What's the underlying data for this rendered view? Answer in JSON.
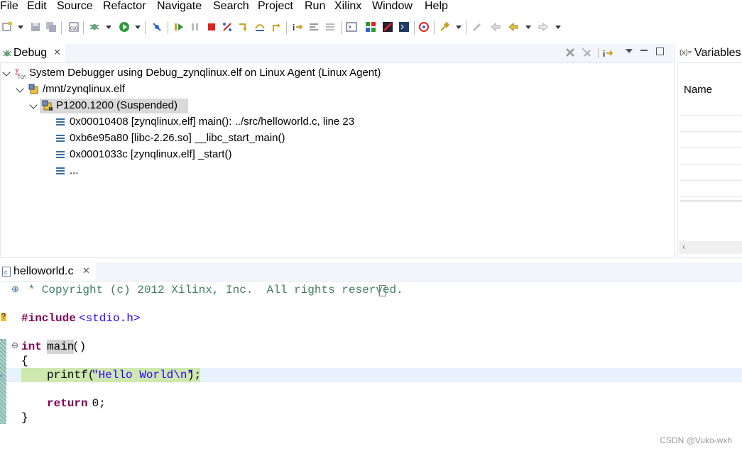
{
  "menu": [
    "File",
    "Edit",
    "Source",
    "Refactor",
    "Navigate",
    "Search",
    "Project",
    "Run",
    "Xilinx",
    "Window",
    "Help"
  ],
  "debug_view": {
    "tab_label": "Debug",
    "tree": {
      "launch": "System Debugger using Debug_zynqlinux.elf on Linux Agent (Linux Agent)",
      "process": "/mnt/zynqlinux.elf",
      "thread": "P1200.1200 (Suspended)",
      "frames": [
        "0x00010408 [zynqlinux.elf] main(): ../src/helloworld.c, line 23",
        "0xb6e95a80 [libc-2.26.so] __libc_start_main()",
        "0x0001033c [zynqlinux.elf] _start()",
        "..."
      ]
    }
  },
  "variables_view": {
    "tab_label": "Variables",
    "tab_prefix": "(x)=",
    "column_name": "Name"
  },
  "editor": {
    "tab_label": "helloworld.c",
    "lines": {
      "copyright": " * Copyright (c) 2012 Xilinx, Inc.  All rights reserved.",
      "include_kw": "#include",
      "include_hdr": "<stdio.h>",
      "int_kw": "int",
      "main_name": "main",
      "main_parens": "()",
      "open_brace": "{",
      "printf_pre": "printf(",
      "printf_str": "\"Hello World\\n\"",
      "printf_post": ");",
      "return_kw": "return",
      "return_val": " 0;",
      "close_brace": "}"
    }
  },
  "watermark": "CSDN @Vuko-wxh",
  "colors": {
    "keyword": "#7f0055",
    "comment": "#3f7f5f",
    "string": "#2a00ff",
    "current_line": "#e8f2fe",
    "selection": "#cfe8b0"
  }
}
